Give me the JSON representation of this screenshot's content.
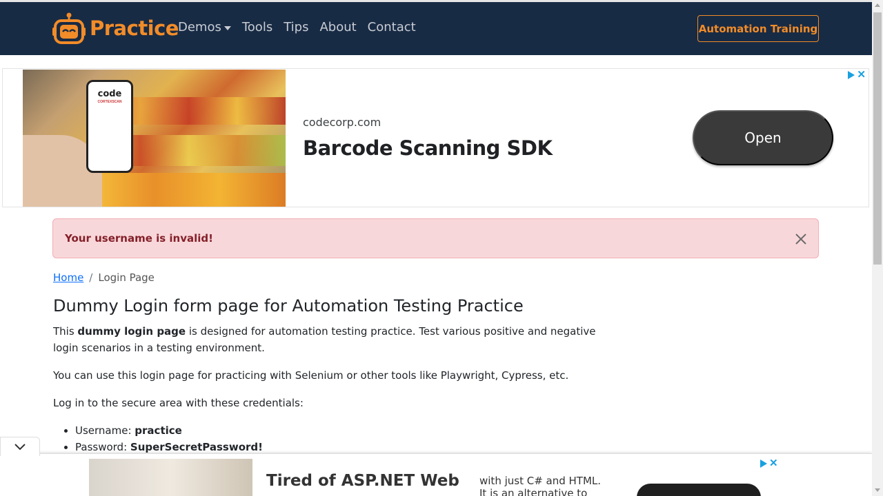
{
  "navbar": {
    "brand": "Practice",
    "items": [
      {
        "label": "Demos",
        "has_dropdown": true
      },
      {
        "label": "Tools"
      },
      {
        "label": "Tips"
      },
      {
        "label": "About"
      },
      {
        "label": "Contact"
      }
    ],
    "cta": "Automation Training",
    "colors": {
      "background": "#182b45",
      "accent": "#f28c28",
      "link": "#c8ccd3"
    }
  },
  "ad_top": {
    "phone_brand": "code",
    "phone_sub": "CORTEXSCAN",
    "domain": "codecorp.com",
    "title": "Barcode Scanning SDK",
    "button": "Open"
  },
  "alert": {
    "message": "Your username is invalid!",
    "colors": {
      "background": "#f8d7da",
      "text": "#842029"
    }
  },
  "breadcrumb": {
    "home": "Home",
    "separator": "/",
    "current": "Login Page"
  },
  "content": {
    "title": "Dummy Login form page for Automation Testing Practice",
    "intro_prefix": "This ",
    "intro_bold": "dummy login page",
    "intro_suffix": " is designed for automation testing practice. Test various positive and negative login scenarios in a testing environment.",
    "para2": "You can use this login page for practicing with Selenium or other tools like Playwright, Cypress, etc.",
    "para3": "Log in to the secure area with these credentials:",
    "credentials": [
      {
        "label": "Username: ",
        "value": "practice"
      },
      {
        "label": "Password: ",
        "value": "SuperSecretPassword!"
      }
    ]
  },
  "ad_bottom": {
    "title": "Tired of ASP.NET Web",
    "text_line1": "with just C# and HTML.",
    "text_line2": "It is an alternative to"
  },
  "icons": {
    "collapse": "chevron-down-icon",
    "ad_choices": "adchoices-icon",
    "close": "close-icon"
  }
}
